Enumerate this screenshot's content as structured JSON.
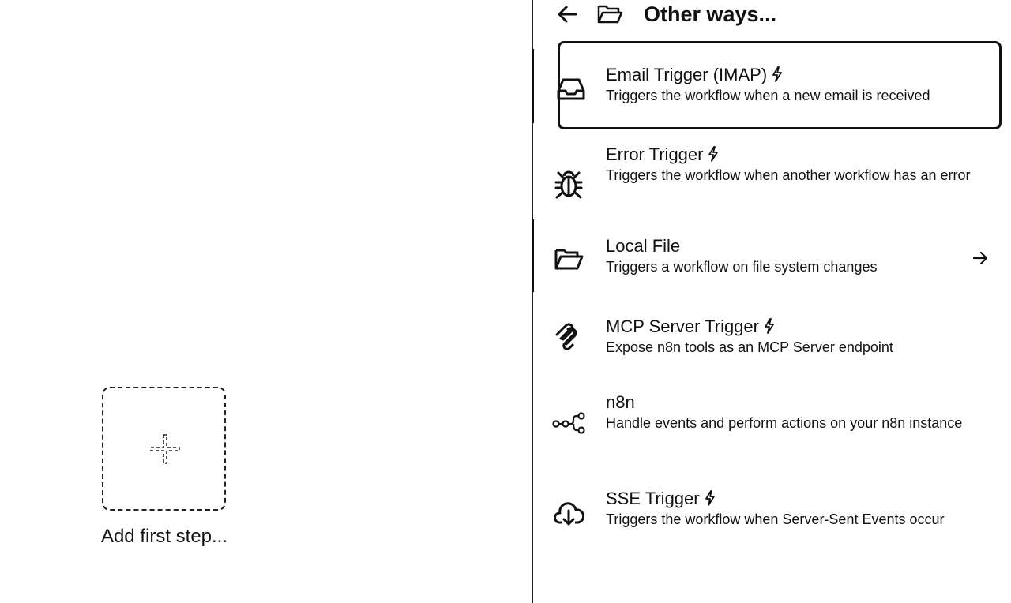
{
  "canvas": {
    "add_first_step_label": "Add first step..."
  },
  "panel": {
    "title": "Other ways...",
    "items": [
      {
        "name": "Email Trigger (IMAP)",
        "description": "Triggers the workflow when a new email is received",
        "icon": "inbox-icon",
        "trigger": true
      },
      {
        "name": "Error Trigger",
        "description": "Triggers the workflow when another workflow has an error",
        "icon": "bug-icon",
        "trigger": true
      },
      {
        "name": "Local File",
        "description": "Triggers a workflow on file system changes",
        "icon": "folder-open-icon",
        "trigger": false,
        "has_subcategory": true
      },
      {
        "name": "MCP Server Trigger",
        "description": "Expose n8n tools as an MCP Server endpoint",
        "icon": "mcp-icon",
        "trigger": true
      },
      {
        "name": "n8n",
        "description": "Handle events and perform actions on your n8n instance",
        "icon": "n8n-logo-icon",
        "trigger": false
      },
      {
        "name": "SSE Trigger",
        "description": "Triggers the workflow when Server-Sent Events occur",
        "icon": "cloud-download-icon",
        "trigger": true
      }
    ]
  }
}
